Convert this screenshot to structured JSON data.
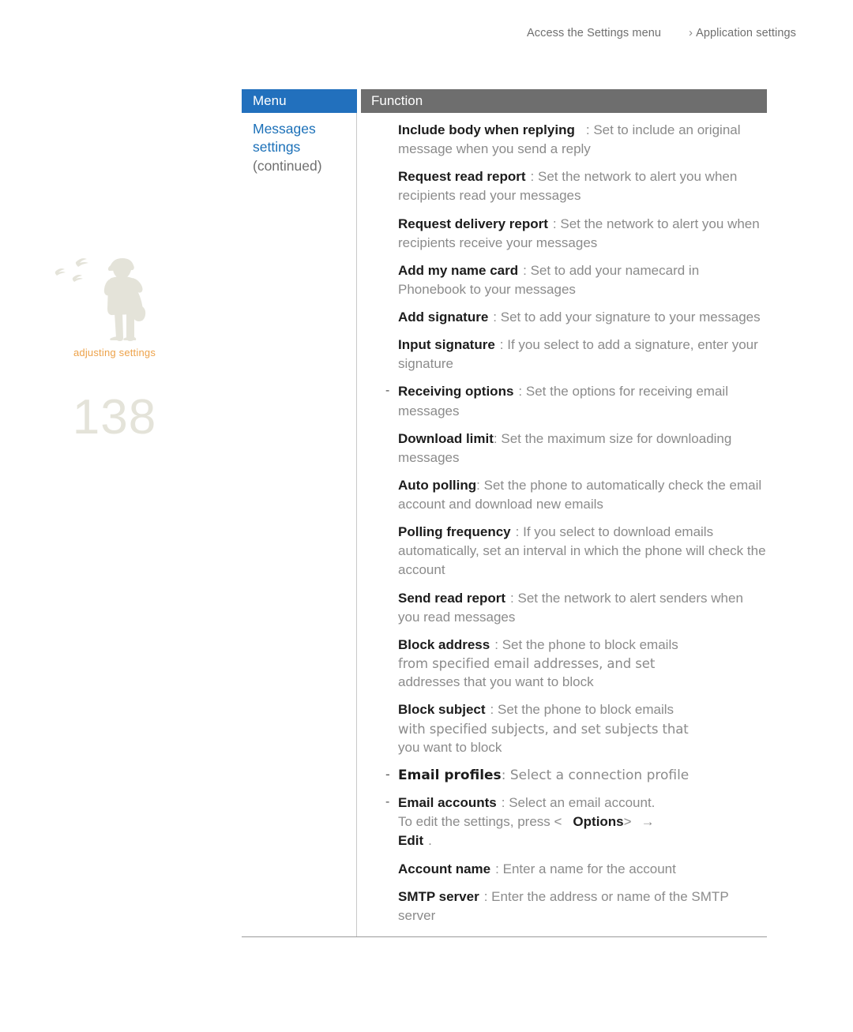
{
  "running_head": {
    "left": "Access the Settings menu",
    "separator": "›",
    "right": "Application settings"
  },
  "margin": {
    "caption": "adjusting settings",
    "page_number": "138",
    "illustration": "birdwatcher-silhouette-illustration"
  },
  "table": {
    "headers": {
      "menu": "Menu",
      "function": "Function"
    },
    "menu_cell": {
      "title_line1": "Messages",
      "title_line2": "settings",
      "subtitle": "(continued)"
    },
    "entries": [
      {
        "dash": "",
        "term": "Include body when replying",
        "colon": ":",
        "desc": "Set to include an original message when you send a reply"
      },
      {
        "dash": "",
        "term": "Request read report",
        "colon": ":",
        "desc": "Set the network to alert you when recipients read your messages"
      },
      {
        "dash": "",
        "term": "Request delivery report",
        "colon": ":",
        "desc": "Set the network to alert you when recipients receive your messages"
      },
      {
        "dash": "",
        "term": "Add my name card",
        "colon": ":",
        "desc": "Set to add your namecard in Phonebook to your messages"
      },
      {
        "dash": "",
        "term": "Add signature",
        "colon": ":",
        "desc": "Set to add your signature to your messages"
      },
      {
        "dash": "",
        "term": "Input signature",
        "colon": ":",
        "desc": "If you select to add a signature, enter your signature"
      },
      {
        "dash": "-",
        "term": "Receiving options",
        "colon": ":",
        "desc": "Set the options for receiving email messages"
      },
      {
        "dash": "",
        "term": "Download limit",
        "colon": ":",
        "desc": "Set the maximum size for downloading messages"
      },
      {
        "dash": "",
        "term": "Auto polling",
        "colon": ":",
        "desc": "Set the phone to automatically check the email account and download new emails"
      },
      {
        "dash": "",
        "term": "Polling frequency",
        "colon": ":",
        "desc": "If you select to download emails automatically, set an interval in which the phone will check the account"
      },
      {
        "dash": "",
        "term": "Send read report",
        "colon": ":",
        "desc": "Set the network to alert senders when you read messages"
      }
    ],
    "block_address": {
      "dash": "",
      "term": "Block address",
      "colon": ":",
      "desc_line1": "Set the phone to block emails",
      "desc_line2": "from specified email addresses, and set",
      "desc_line3": "addresses that you want to block"
    },
    "block_subject": {
      "dash": "",
      "term": "Block subject",
      "colon": ":",
      "desc_line1": "Set the phone to block emails",
      "desc_line2": "with specified subjects, and set subjects that",
      "desc_line3": "you want to block"
    },
    "email_profiles": {
      "dash": "-",
      "term": "Email profiles",
      "colon": ":",
      "desc": "Select a connection profile"
    },
    "email_accounts": {
      "dash": "-",
      "term": "Email accounts",
      "colon": ":",
      "desc": "Select an email account.",
      "instruction_prefix": "To edit the settings, press <",
      "instruction_key": "Options",
      "instruction_bracket": ">",
      "instruction_arrow": "→",
      "instruction_key2": "Edit",
      "instruction_period": "."
    },
    "trailing_entries": [
      {
        "dash": "",
        "term": "Account name",
        "colon": ":",
        "desc": "Enter a name for the account"
      },
      {
        "dash": "",
        "term": "SMTP server",
        "colon": ":",
        "desc": "Enter the address or name of the SMTP server"
      }
    ]
  },
  "colors": {
    "header_menu_bg": "#2270bd",
    "header_function_bg": "#6e6e6e",
    "menu_title": "#1b70b8",
    "caption_orange": "#eda24a",
    "page_number": "#e4e3d9",
    "term": "#1c1c1c",
    "desc": "#8b8b8b"
  }
}
